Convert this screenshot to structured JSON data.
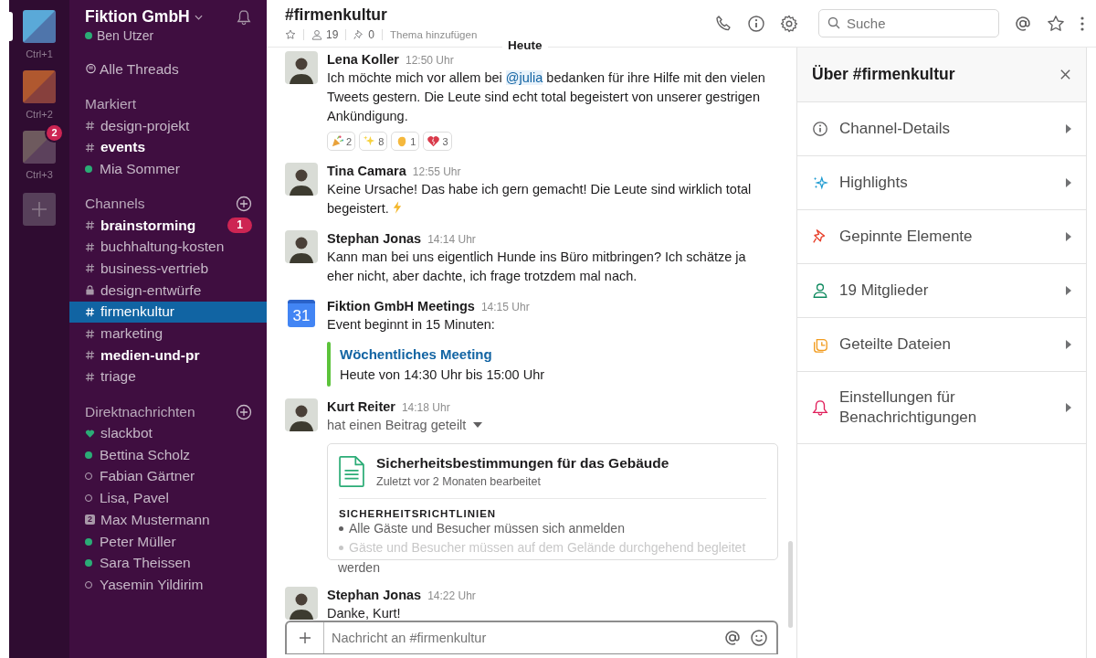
{
  "workspaces": [
    {
      "shortcut": "Ctrl+1",
      "color": "#5aa9d8",
      "selected": true
    },
    {
      "shortcut": "Ctrl+2",
      "color": "#b0582f",
      "selected": false
    },
    {
      "shortcut": "Ctrl+3",
      "color": "#6e5a5e",
      "selected": false,
      "badge": "2"
    }
  ],
  "team": {
    "name": "Fiktion GmbH",
    "user": "Ben Utzer",
    "online": true
  },
  "threads": {
    "label": "Alle Threads"
  },
  "sections": [
    {
      "title": "Markiert",
      "add": false,
      "items": [
        {
          "kind": "channel",
          "label": "design-projekt",
          "unread": false,
          "selected": false
        },
        {
          "kind": "channel",
          "label": "events",
          "unread": true,
          "selected": false
        },
        {
          "kind": "dm",
          "online": true,
          "label": "Mia Sommer",
          "unread": false,
          "selected": false
        }
      ]
    },
    {
      "title": "Channels",
      "add": true,
      "items": [
        {
          "kind": "channel",
          "label": "brainstorming",
          "unread": true,
          "selected": false,
          "badge": "1"
        },
        {
          "kind": "channel",
          "label": "buchhaltung-kosten",
          "unread": false,
          "selected": false
        },
        {
          "kind": "channel",
          "label": "business-vertrieb",
          "unread": false,
          "selected": false
        },
        {
          "kind": "private",
          "label": "design-entwürfe",
          "unread": false,
          "selected": false
        },
        {
          "kind": "channel",
          "label": "firmenkultur",
          "unread": false,
          "selected": true
        },
        {
          "kind": "channel",
          "label": "marketing",
          "unread": false,
          "selected": false
        },
        {
          "kind": "channel",
          "label": "medien-und-pr",
          "unread": true,
          "selected": false
        },
        {
          "kind": "channel",
          "label": "triage",
          "unread": false,
          "selected": false
        }
      ]
    },
    {
      "title": "Direktnachrichten",
      "add": true,
      "items": [
        {
          "kind": "bot",
          "label": "slackbot",
          "unread": false,
          "selected": false
        },
        {
          "kind": "dm",
          "online": true,
          "label": "Bettina Scholz",
          "unread": false,
          "selected": false
        },
        {
          "kind": "dm",
          "online": false,
          "label": "Fabian Gärtner",
          "unread": false,
          "selected": false
        },
        {
          "kind": "dm",
          "online": false,
          "label": "Lisa, Pavel",
          "unread": false,
          "selected": false
        },
        {
          "kind": "group",
          "count": "2",
          "label": "Max Mustermann",
          "unread": false,
          "selected": false
        },
        {
          "kind": "dm",
          "online": true,
          "label": "Peter Müller",
          "unread": false,
          "selected": false
        },
        {
          "kind": "dm",
          "online": true,
          "label": "Sara Theissen",
          "unread": false,
          "selected": false
        },
        {
          "kind": "dm",
          "online": false,
          "label": "Yasemin Yildirim",
          "unread": false,
          "selected": false
        }
      ]
    }
  ],
  "channel": {
    "title": "#firmenkultur",
    "members": "19",
    "pins": "0",
    "topic_placeholder": "Thema hinzufügen"
  },
  "search": {
    "placeholder": "Suche"
  },
  "day_divider": "Heute",
  "messages": [
    {
      "kind": "person",
      "author": "Lena Koller",
      "time": "12:50 Uhr",
      "segments": [
        {
          "kind": "text",
          "text": "Ich möchte mich vor allem bei "
        },
        {
          "kind": "mention",
          "text": "@julia"
        },
        {
          "kind": "text",
          "text": " bedanken für ihre Hilfe mit den vielen Tweets gestern. Die Leute sind echt total begeistert von unserer gestrigen Ankündigung."
        }
      ],
      "reactions": [
        {
          "kind": "party",
          "count": "2"
        },
        {
          "kind": "sparkles",
          "count": "8"
        },
        {
          "kind": "clap",
          "count": "1"
        },
        {
          "kind": "heart",
          "count": "3"
        }
      ]
    },
    {
      "kind": "person",
      "author": "Tina Camara",
      "time": "12:55 Uhr",
      "segments": [
        {
          "kind": "text",
          "text": "Keine Ursache! Das habe ich gern gemacht! Die Leute sind wirklich total begeistert. "
        },
        {
          "kind": "lightning"
        }
      ]
    },
    {
      "kind": "person",
      "author": "Stephan Jonas",
      "time": "14:14 Uhr",
      "segments": [
        {
          "kind": "text",
          "text": "Kann man bei uns eigentlich Hunde ins Büro mitbringen? Ich schätze ja eher nicht, aber dachte, ich frage trotzdem mal nach."
        }
      ]
    },
    {
      "kind": "calendar",
      "avatar_text": "31",
      "author": "Fiktion GmbH Meetings",
      "time": "14:15 Uhr",
      "segments": [
        {
          "kind": "text",
          "text": "Event beginnt in 15 Minuten:"
        }
      ],
      "attachment": {
        "color": "#5cc33b",
        "title": "Wöchentliches Meeting",
        "text": "Heute von 14:30 Uhr bis 15:00 Uhr"
      }
    },
    {
      "kind": "person",
      "author": "Kurt Reiter",
      "time": "14:18 Uhr",
      "segments": [
        {
          "kind": "muted",
          "text": "hat einen Beitrag geteilt"
        },
        {
          "kind": "caret"
        }
      ],
      "post": {
        "title": "Sicherheitsbestimmungen für das Gebäude",
        "subtitle": "Zuletzt vor 2 Monaten bearbeitet",
        "heading": "SICHERHEITSRICHTLINIEN",
        "bullets": [
          "Alle Gäste und Besucher müssen sich anmelden",
          "Gäste und Besucher müssen auf dem Gelände durchgehend begleitet"
        ],
        "overflow": "werden"
      }
    },
    {
      "kind": "person",
      "author": "Stephan Jonas",
      "time": "14:22 Uhr",
      "segments": [
        {
          "kind": "text",
          "text": "Danke, Kurt!"
        }
      ]
    }
  ],
  "composer": {
    "placeholder": "Nachricht an #firmenkultur"
  },
  "details": {
    "title": "Über #firmenkultur",
    "items": [
      {
        "kind": "info",
        "label": "Channel-Details"
      },
      {
        "kind": "highlights",
        "label": "Highlights"
      },
      {
        "kind": "pin",
        "label": "Gepinnte Elemente"
      },
      {
        "kind": "members",
        "label": "19 Mitglieder"
      },
      {
        "kind": "files",
        "label": "Geteilte Dateien"
      },
      {
        "kind": "bell",
        "label": "Einstellungen für Benachrichtigungen"
      }
    ]
  }
}
